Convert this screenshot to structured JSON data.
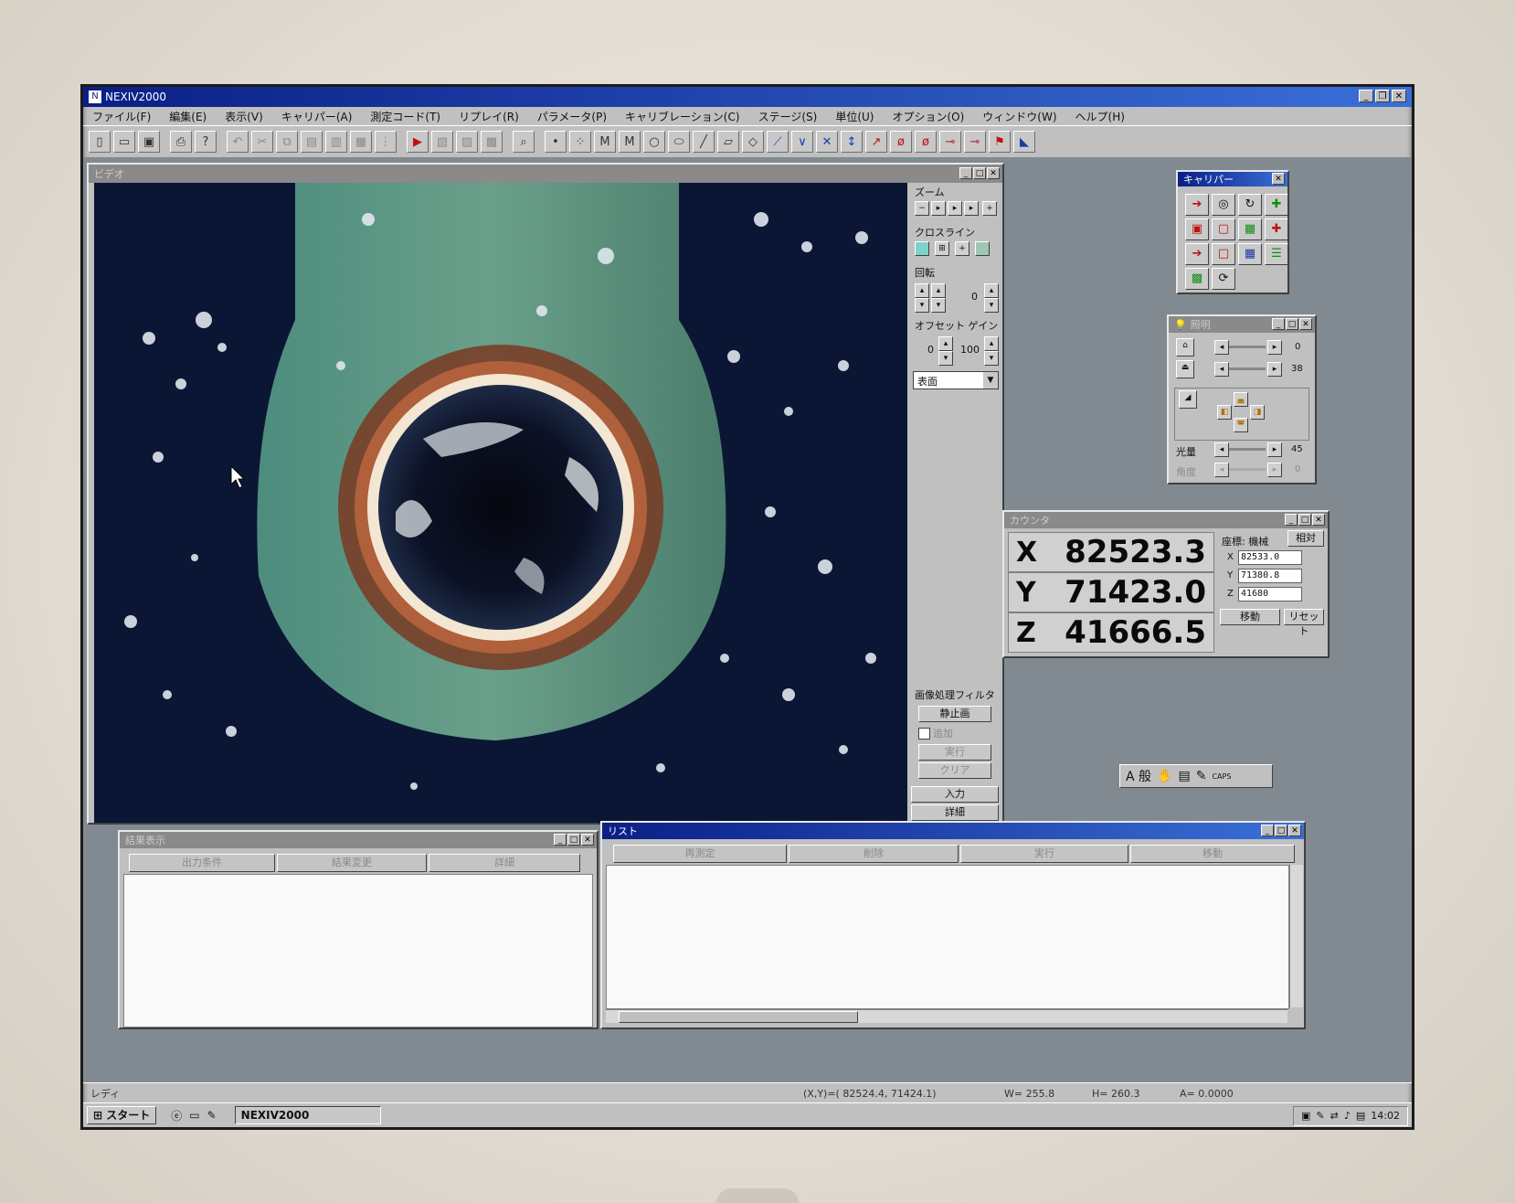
{
  "app": {
    "title": "NEXIV2000"
  },
  "menu": [
    "ファイル(F)",
    "編集(E)",
    "表示(V)",
    "キャリパー(A)",
    "測定コード(T)",
    "リプレイ(R)",
    "パラメータ(P)",
    "キャリブレーション(C)",
    "ステージ(S)",
    "単位(U)",
    "オプション(O)",
    "ウィンドウ(W)",
    "ヘルプ(H)"
  ],
  "video": {
    "title": "ビデオ",
    "zoom_label": "ズーム",
    "crossline_label": "クロスライン",
    "rotation_label": "回転",
    "rotation_value": "0",
    "offset_gain_label": "オフセット ゲイン",
    "offset_value": "0",
    "gain_value": "100",
    "surface_select": "表面",
    "filter_label": "画像処理フィルタ",
    "still_button": "静止画",
    "add_checkbox": "追加",
    "execute_button": "実行",
    "clear_button": "クリア",
    "input_button": "入力",
    "detail_button": "詳細"
  },
  "caliper": {
    "title": "キャリパー"
  },
  "lighting": {
    "title": "照明",
    "row1_value": "0",
    "row2_value": "38",
    "light_amount_label": "光量",
    "light_amount_value": "45",
    "angle_label": "角度",
    "angle_value": "0"
  },
  "counter": {
    "title": "カウンタ",
    "rows": [
      {
        "axis": "X",
        "value": "82523.3"
      },
      {
        "axis": "Y",
        "value": "71423.0"
      },
      {
        "axis": "Z",
        "value": "41666.5"
      }
    ],
    "coord_label": "座標: 機械",
    "relative_button": "相対",
    "target_x": "82533.0",
    "target_y": "71380.8",
    "target_z": "41680",
    "move_button": "移動",
    "reset_button": "リセット"
  },
  "ime_bar": {
    "text": "A 般"
  },
  "results": {
    "title": "結果表示",
    "columns": [
      "出力条件",
      "結果変更",
      "詳細"
    ]
  },
  "list": {
    "title": "リスト",
    "columns": [
      "再測定",
      "削除",
      "実行",
      "移動"
    ]
  },
  "status": {
    "ready": "レディ",
    "xy": "(X,Y)=(  82524.4,   71424.1)",
    "w": "W=   255.8",
    "h": "H=   260.3",
    "a": "A=  0.0000"
  },
  "taskbar": {
    "start": "スタート",
    "task": "NEXIV2000",
    "clock": "14:02"
  }
}
